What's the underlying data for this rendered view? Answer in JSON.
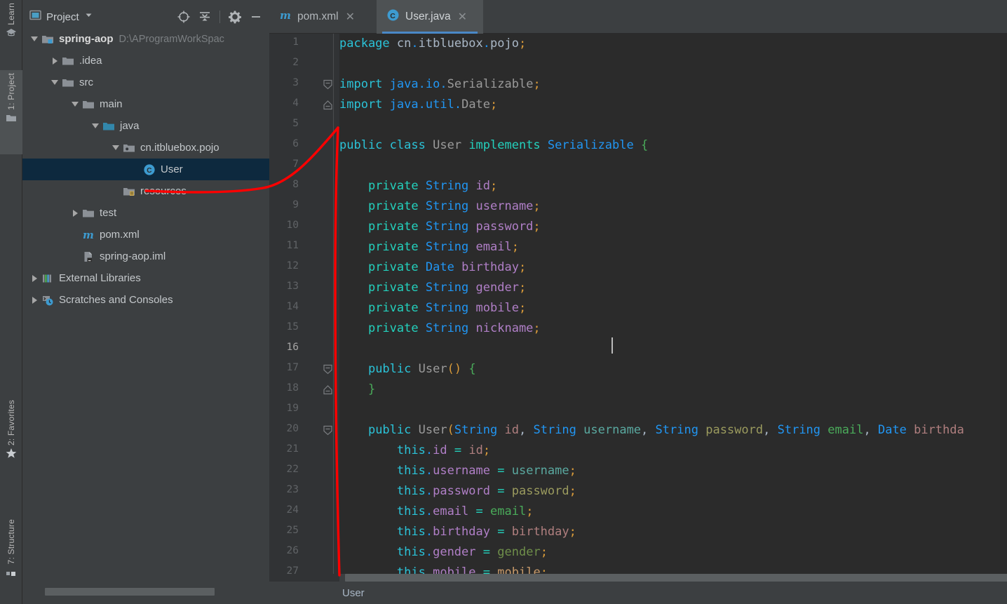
{
  "window": {
    "theme_bg": "#3c3f41",
    "editor_bg": "#2b2b2b",
    "accent": "#4a88c7",
    "selection_bg": "#0d293e",
    "annotation_color": "#ff0000"
  },
  "left_rail": {
    "items": [
      {
        "label": "Learn",
        "icon": "graduation-cap-icon",
        "active": false
      },
      {
        "label": "1: Project",
        "icon": "folder-icon",
        "active": true
      },
      {
        "label": "2: Favorites",
        "icon": "star-icon",
        "active": false
      },
      {
        "label": "7: Structure",
        "icon": "structure-icon",
        "active": false
      }
    ]
  },
  "project_panel": {
    "title": "Project",
    "title_icon": "project-view-icon",
    "dropdown_icon": "chevron-down-icon",
    "toolbar_buttons": [
      {
        "name": "locate-icon",
        "label": "Select Opened File"
      },
      {
        "name": "collapse-all-icon",
        "label": "Collapse All"
      },
      {
        "name": "gear-icon",
        "label": "Settings"
      },
      {
        "name": "minimize-icon",
        "label": "Hide"
      }
    ],
    "tree": [
      {
        "label": "spring-aop",
        "sub": "D:\\AProgramWorkSpac",
        "icon": "module-folder-icon",
        "indent": 0,
        "expanded": true,
        "bold": true,
        "selected": false
      },
      {
        "label": ".idea",
        "sub": "",
        "icon": "folder-icon",
        "indent": 1,
        "expanded": false,
        "bold": false,
        "selected": false
      },
      {
        "label": "src",
        "sub": "",
        "icon": "folder-icon",
        "indent": 1,
        "expanded": true,
        "bold": false,
        "selected": false
      },
      {
        "label": "main",
        "sub": "",
        "icon": "folder-icon",
        "indent": 2,
        "expanded": true,
        "bold": false,
        "selected": false
      },
      {
        "label": "java",
        "sub": "",
        "icon": "source-root-folder-icon",
        "indent": 3,
        "expanded": true,
        "bold": false,
        "selected": false
      },
      {
        "label": "cn.itbluebox.pojo",
        "sub": "",
        "icon": "package-icon",
        "indent": 4,
        "expanded": true,
        "bold": false,
        "selected": false
      },
      {
        "label": "User",
        "sub": "",
        "icon": "java-class-icon",
        "indent": 5,
        "expanded": null,
        "bold": false,
        "selected": true
      },
      {
        "label": "resources",
        "sub": "",
        "icon": "resource-folder-icon",
        "indent": 4,
        "expanded": null,
        "bold": false,
        "selected": false
      },
      {
        "label": "test",
        "sub": "",
        "icon": "folder-icon",
        "indent": 2,
        "expanded": false,
        "bold": false,
        "selected": false
      },
      {
        "label": "pom.xml",
        "sub": "",
        "icon": "maven-icon",
        "indent": 2,
        "expanded": null,
        "bold": false,
        "selected": false
      },
      {
        "label": "spring-aop.iml",
        "sub": "",
        "icon": "iml-file-icon",
        "indent": 2,
        "expanded": null,
        "bold": false,
        "selected": false
      },
      {
        "label": "External Libraries",
        "sub": "",
        "icon": "libraries-icon",
        "indent": 0,
        "expanded": false,
        "bold": false,
        "selected": false
      },
      {
        "label": "Scratches and Consoles",
        "sub": "",
        "icon": "scratches-icon",
        "indent": 0,
        "expanded": false,
        "bold": false,
        "selected": false
      }
    ]
  },
  "editor": {
    "tabs": [
      {
        "label": "pom.xml",
        "icon": "maven-icon",
        "active": false,
        "close_icon": "close-icon"
      },
      {
        "label": "User.java",
        "icon": "java-class-icon",
        "active": true,
        "close_icon": "close-icon"
      }
    ],
    "breadcrumb": "User",
    "current_line": 16,
    "first_visible_line": 1,
    "last_visible_line": 27,
    "line_numbers": [
      1,
      2,
      3,
      4,
      5,
      6,
      7,
      8,
      9,
      10,
      11,
      12,
      13,
      14,
      15,
      16,
      17,
      18,
      19,
      20,
      21,
      22,
      23,
      24,
      25,
      26,
      27
    ],
    "code_lines": [
      {
        "n": 1,
        "text": "package cn.itbluebox.pojo;"
      },
      {
        "n": 2,
        "text": ""
      },
      {
        "n": 3,
        "text": "import java.io.Serializable;"
      },
      {
        "n": 4,
        "text": "import java.util.Date;"
      },
      {
        "n": 5,
        "text": ""
      },
      {
        "n": 6,
        "text": "public class User implements Serializable {"
      },
      {
        "n": 7,
        "text": ""
      },
      {
        "n": 8,
        "text": "    private String id;"
      },
      {
        "n": 9,
        "text": "    private String username;"
      },
      {
        "n": 10,
        "text": "    private String password;"
      },
      {
        "n": 11,
        "text": "    private String email;"
      },
      {
        "n": 12,
        "text": "    private Date birthday;"
      },
      {
        "n": 13,
        "text": "    private String gender;"
      },
      {
        "n": 14,
        "text": "    private String mobile;"
      },
      {
        "n": 15,
        "text": "    private String nickname;"
      },
      {
        "n": 16,
        "text": ""
      },
      {
        "n": 17,
        "text": "    public User() {"
      },
      {
        "n": 18,
        "text": "    }"
      },
      {
        "n": 19,
        "text": ""
      },
      {
        "n": 20,
        "text": "    public User(String id, String username, String password, String email, Date birthda"
      },
      {
        "n": 21,
        "text": "        this.id = id;"
      },
      {
        "n": 22,
        "text": "        this.username = username;"
      },
      {
        "n": 23,
        "text": "        this.password = password;"
      },
      {
        "n": 24,
        "text": "        this.email = email;"
      },
      {
        "n": 25,
        "text": "        this.birthday = birthday;"
      },
      {
        "n": 26,
        "text": "        this.gender = gender;"
      },
      {
        "n": 27,
        "text": "        this.mobile = mobile;"
      }
    ],
    "fold_markers": [
      {
        "line": 3,
        "type": "fold-start-icon"
      },
      {
        "line": 4,
        "type": "fold-end-icon"
      },
      {
        "line": 17,
        "type": "fold-start-icon"
      },
      {
        "line": 18,
        "type": "fold-end-icon"
      },
      {
        "line": 20,
        "type": "fold-start-icon"
      }
    ]
  }
}
